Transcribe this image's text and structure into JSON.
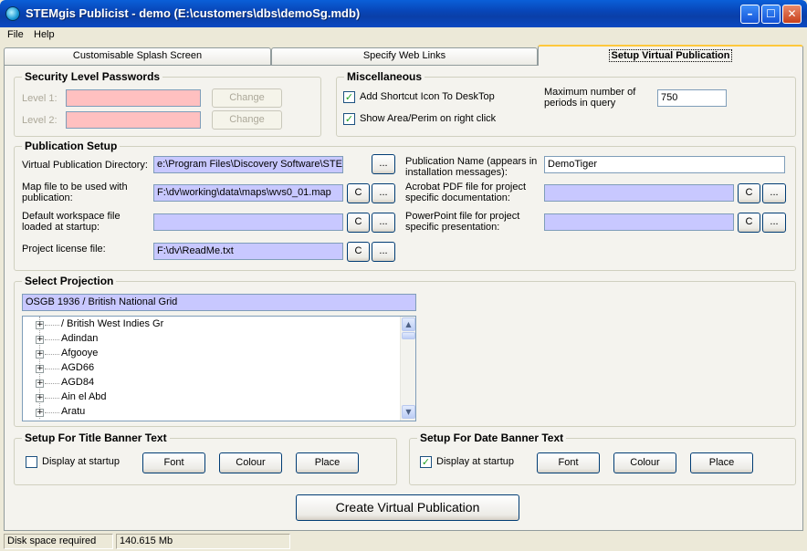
{
  "window": {
    "title": "STEMgis Publicist - demo (E:\\customers\\dbs\\demoSg.mdb)"
  },
  "menu": [
    "File",
    "Help"
  ],
  "tabs": [
    {
      "label": "Customisable Splash Screen",
      "active": false
    },
    {
      "label": "Specify Web Links",
      "active": false
    },
    {
      "label": "Setup Virtual Publication",
      "active": true
    }
  ],
  "security": {
    "title": "Security Level Passwords",
    "level1_label": "Level 1:",
    "level2_label": "Level 2:",
    "change_label": "Change"
  },
  "misc": {
    "title": "Miscellaneous",
    "shortcut_label": "Add Shortcut Icon To DeskTop",
    "shortcut_checked": true,
    "showarea_label": "Show Area/Perim on right click",
    "showarea_checked": true,
    "max_periods_label": "Maximum number of periods in query",
    "max_periods_value": "750"
  },
  "pubsetup": {
    "title": "Publication Setup",
    "vpd_label": "Virtual Publication Directory:",
    "vpd_value": "e:\\Program Files\\Discovery Software\\STE",
    "mapfile_label": "Map file to be used with publication:",
    "mapfile_value": "F:\\dv\\working\\data\\maps\\wvs0_01.map",
    "workspace_label": "Default workspace file loaded at startup:",
    "workspace_value": "",
    "license_label": "Project license file:",
    "license_value": "F:\\dv\\ReadMe.txt",
    "pubname_label": "Publication Name (appears in installation messages):",
    "pubname_value": "DemoTiger",
    "pdf_label": "Acrobat PDF file for project specific documentation:",
    "pdf_value": "",
    "ppt_label": "PowerPoint file for project specific presentation:",
    "ppt_value": "",
    "clear_label": "C",
    "browse_label": "..."
  },
  "projection": {
    "title": "Select Projection",
    "selected": "OSGB 1936 / British National Grid",
    "items": [
      "/ British West Indies Gr",
      "Adindan",
      "Afgooye",
      "AGD66",
      "AGD84",
      "Ain el Abd",
      "Aratu"
    ]
  },
  "title_banner": {
    "title": "Setup For Title Banner Text",
    "display_label": "Display at startup",
    "display_checked": false,
    "font_label": "Font",
    "colour_label": "Colour",
    "place_label": "Place"
  },
  "date_banner": {
    "title": "Setup For Date Banner Text",
    "display_label": "Display at startup",
    "display_checked": true,
    "font_label": "Font",
    "colour_label": "Colour",
    "place_label": "Place"
  },
  "create_label": "Create Virtual Publication",
  "status": {
    "disk_label": "Disk space required",
    "disk_value": "140.615 Mb"
  },
  "colors": {
    "pink_field": "#ffc0c0",
    "lavender_field": "#c8c8ff",
    "titlebar": "#0a46b8"
  }
}
